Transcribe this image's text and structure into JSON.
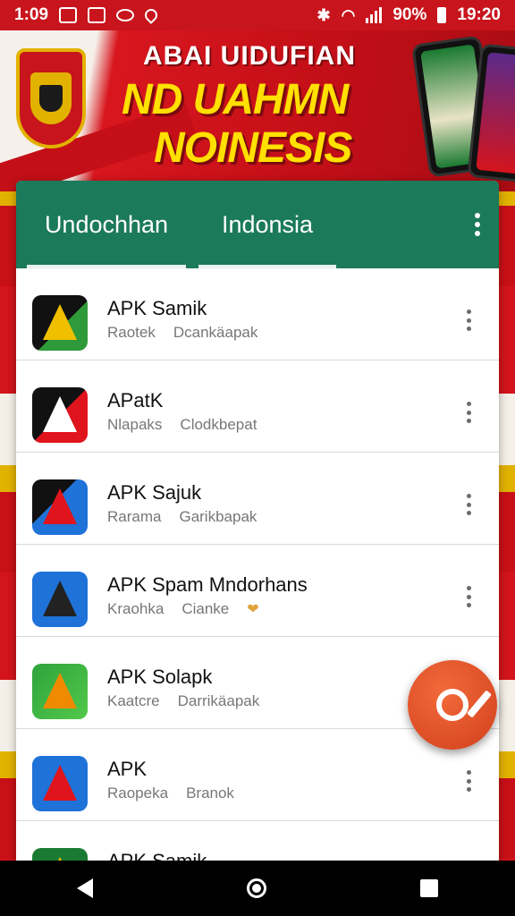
{
  "status_bar": {
    "time_left": "1:09",
    "battery_percent": "90%",
    "time_right": "19:20"
  },
  "banner": {
    "line1": "ABAI UIDUFIAN",
    "line2": "ND UAHMN",
    "line3": "NOINESIS"
  },
  "tabs": [
    {
      "label": "Undochhan"
    },
    {
      "label": "Indonsia"
    }
  ],
  "apps": [
    {
      "title": "APK Samik",
      "sub1": "Raotek",
      "sub2": "Dcankäapak"
    },
    {
      "title": "APatK",
      "sub1": "Nlapaks",
      "sub2": "Clodkbepat"
    },
    {
      "title": "APK Sajuk",
      "sub1": "Rarama",
      "sub2": "Garikbapak"
    },
    {
      "title": "APK Spam Mndorhans",
      "sub1": "Kraohka",
      "sub2": "Cianke"
    },
    {
      "title": "APK Solapk",
      "sub1": "Kaatcre",
      "sub2": "Darrikäapak"
    },
    {
      "title": "APK",
      "sub1": "Raopeka",
      "sub2": "Branok"
    },
    {
      "title": "APK Samik",
      "sub1": "",
      "sub2": ""
    }
  ],
  "colors": {
    "toolbar": "#1b7a5a",
    "fab": "#e0522c",
    "banner_red": "#c40f18",
    "banner_yellow": "#ffe000"
  }
}
